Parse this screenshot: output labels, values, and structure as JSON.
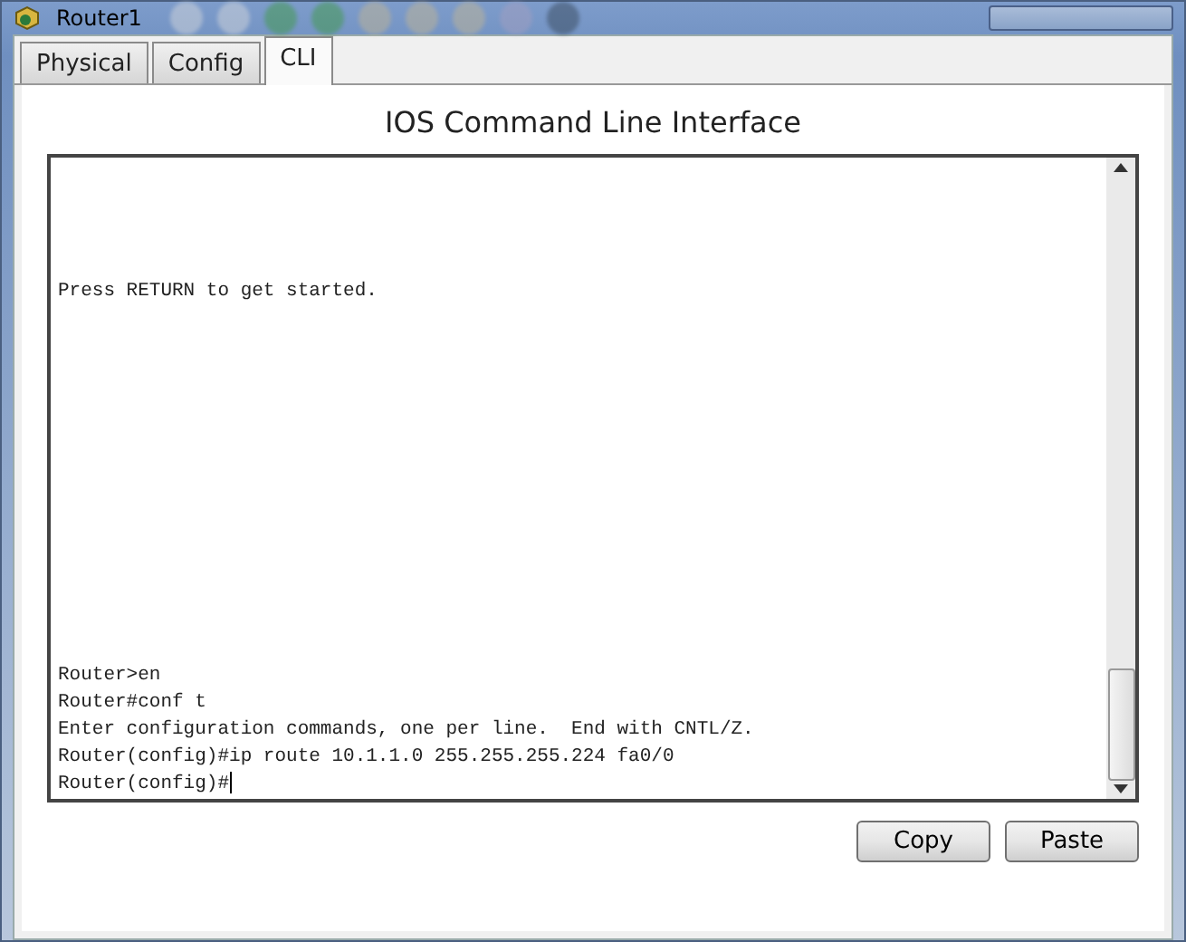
{
  "window": {
    "title": "Router1"
  },
  "tabs": [
    {
      "label": "Physical",
      "selected": false
    },
    {
      "label": "Config",
      "selected": false
    },
    {
      "label": "CLI",
      "selected": true
    }
  ],
  "heading": "IOS Command Line Interface",
  "terminal": {
    "banner_lines": [
      "Press RETURN to get started."
    ],
    "lines": [
      "Router>en",
      "Router#conf t",
      "Enter configuration commands, one per line.  End with CNTL/Z.",
      "Router(config)#ip route 10.1.1.0 255.255.255.224 fa0/0",
      "Router(config)#"
    ]
  },
  "buttons": [
    "Copy",
    "Paste"
  ]
}
